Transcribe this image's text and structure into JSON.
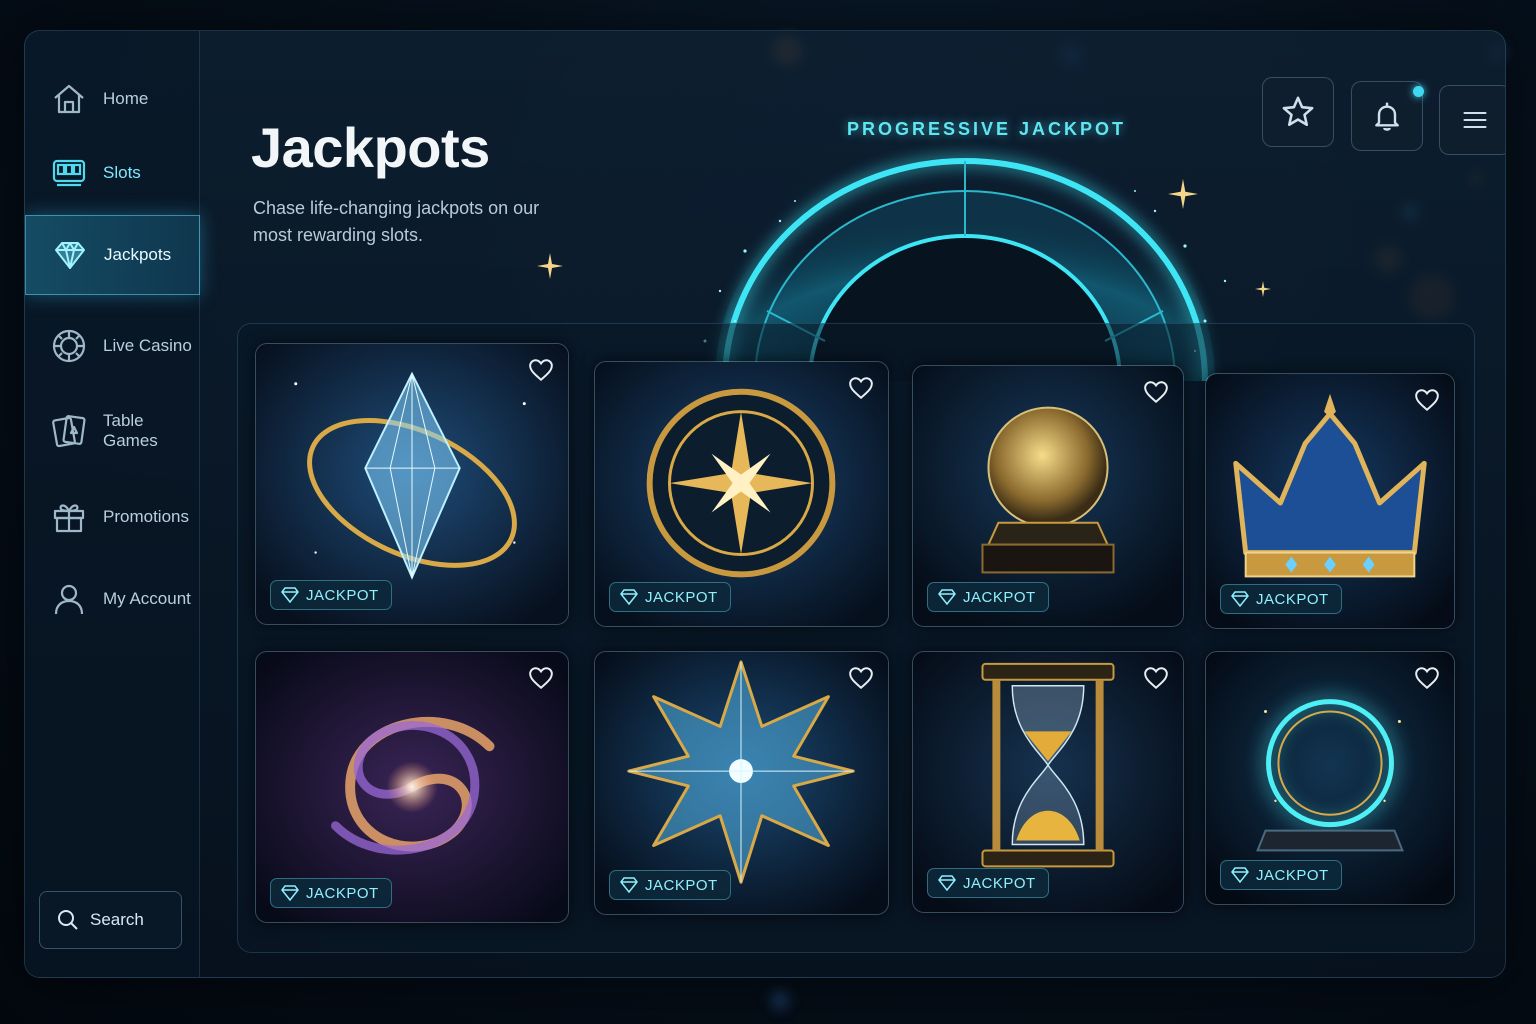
{
  "sidebar": {
    "items": [
      {
        "label": "Home",
        "icon": "home-icon"
      },
      {
        "label": "Slots",
        "icon": "slot-machine-icon"
      },
      {
        "label": "Jackpots",
        "icon": "diamond-icon"
      },
      {
        "label": "Live Casino",
        "icon": "roulette-chip-icon"
      },
      {
        "label": "Table Games",
        "icon": "playing-cards-icon"
      },
      {
        "label": "Promotions",
        "icon": "gift-icon"
      },
      {
        "label": "My Account",
        "icon": "user-icon"
      }
    ],
    "active": "Jackpots",
    "search_label": "Search"
  },
  "header": {
    "title": "Jackpots",
    "subtitle": "Chase life-changing jackpots on our most rewarding slots.",
    "banner_label": "PROGRESSIVE JACKPOT"
  },
  "top_actions": [
    {
      "icon": "star-icon"
    },
    {
      "icon": "bell-icon",
      "has_notification": true
    },
    {
      "icon": "menu-icon"
    }
  ],
  "games": [
    {
      "art": "crystal-orbit",
      "badge": "JACKPOT"
    },
    {
      "art": "compass-wheel",
      "badge": "JACKPOT"
    },
    {
      "art": "crystal-ball",
      "badge": "JACKPOT"
    },
    {
      "art": "crown",
      "badge": "JACKPOT"
    },
    {
      "art": "galaxy-spiral",
      "badge": "JACKPOT"
    },
    {
      "art": "crystal-star",
      "badge": "JACKPOT"
    },
    {
      "art": "hourglass",
      "badge": "JACKPOT"
    },
    {
      "art": "glowing-portal",
      "badge": "JACKPOT"
    }
  ],
  "colors": {
    "accent": "#5fe6f2",
    "gold": "#d9a948",
    "background": "#06111d"
  }
}
